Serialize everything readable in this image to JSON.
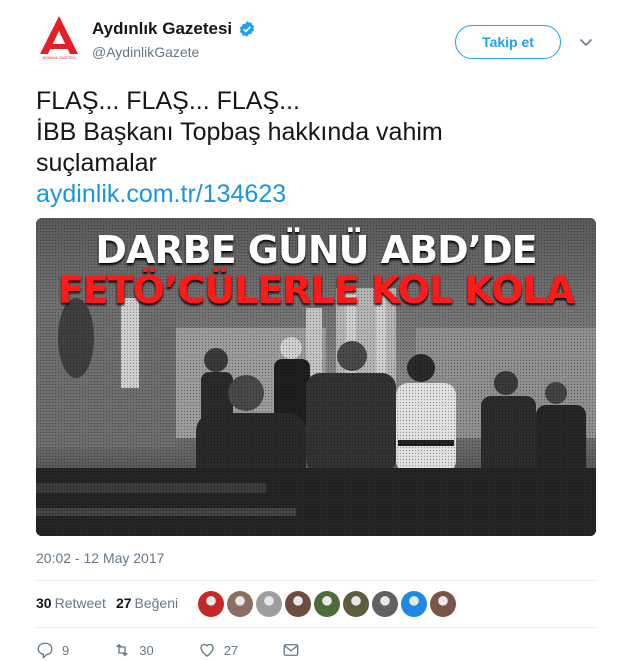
{
  "account": {
    "name": "Aydınlık Gazetesi",
    "handle": "@AydinlikGazete",
    "logo_letter": "A",
    "logo_wordmark": "AYDINLIK GAZETESİ",
    "brand_color": "#e3202a"
  },
  "follow_label": "Takip et",
  "tweet": {
    "line1": "FLAŞ... FLAŞ... FLAŞ...",
    "line2": "İBB Başkanı Topbaş hakkında vahim",
    "line3": "suçlamalar",
    "link": "aydinlik.com.tr/134623"
  },
  "media": {
    "headline_1": "DARBE GÜNÜ ABD’DE",
    "headline_2": "FETÖ’CÜLERLE KOL KOLA",
    "headline_2_color": "#ff1a1a"
  },
  "timestamp": "20:02 - 12 May 2017",
  "stats": {
    "retweet_count": "30",
    "retweet_label": "Retweet",
    "like_count": "27",
    "like_label": "Beğeni"
  },
  "liker_avatars": [
    {
      "icon": "avatar-red-logo",
      "color": "#c62828"
    },
    {
      "icon": "avatar-landscape",
      "color": "#8d6e63"
    },
    {
      "icon": "avatar-person",
      "color": "#9e9e9e"
    },
    {
      "icon": "avatar-portrait",
      "color": "#6d4c41"
    },
    {
      "icon": "avatar-flag",
      "color": "#4e6b3a"
    },
    {
      "icon": "avatar-soldier",
      "color": "#5d5d3f"
    },
    {
      "icon": "avatar-man",
      "color": "#616161"
    },
    {
      "icon": "avatar-blue-flag",
      "color": "#1e88e5"
    },
    {
      "icon": "avatar-group",
      "color": "#795548"
    }
  ],
  "actions": {
    "reply_count": "9",
    "retweet_count": "30",
    "like_count": "27"
  },
  "colors": {
    "link": "#1b95e0",
    "secondary_text": "#657786",
    "follow_blue": "#1da1f2"
  }
}
